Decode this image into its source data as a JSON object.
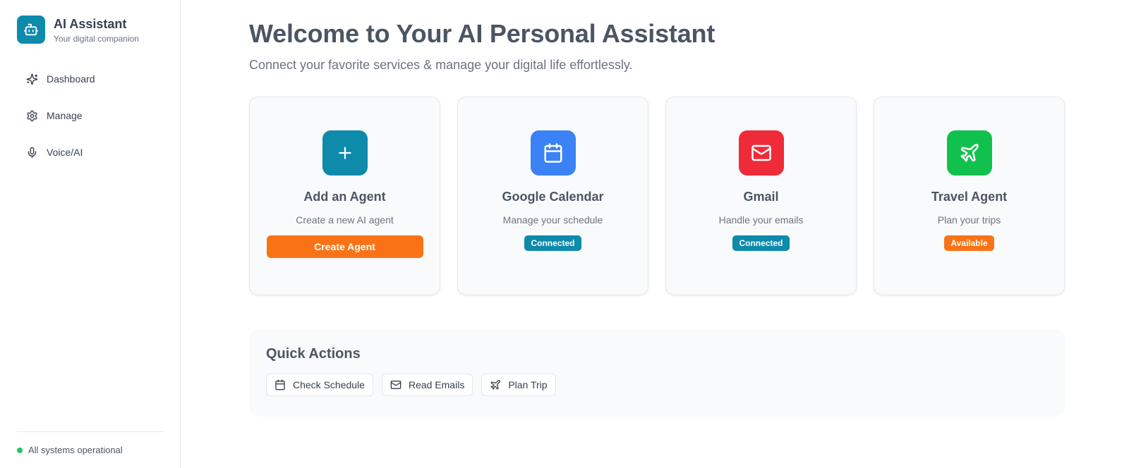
{
  "brand": {
    "title": "AI Assistant",
    "subtitle": "Your digital companion",
    "color": "#0e8aab",
    "icon": "bot-icon"
  },
  "nav": {
    "items": [
      {
        "label": "Dashboard",
        "icon": "sparkles-icon"
      },
      {
        "label": "Manage",
        "icon": "gear-icon"
      },
      {
        "label": "Voice/AI",
        "icon": "mic-icon"
      }
    ]
  },
  "status": {
    "text": "All systems operational",
    "color": "#22c55e"
  },
  "header": {
    "title": "Welcome to Your AI Personal Assistant",
    "subtitle": "Connect your favorite services & manage your digital life effortlessly."
  },
  "cards": [
    {
      "title": "Add an Agent",
      "description": "Create a new AI agent",
      "icon": "plus-icon",
      "icon_color": "#0e8aab",
      "button_label": "Create Agent",
      "button_color": "#f97316"
    },
    {
      "title": "Google Calendar",
      "description": "Manage your schedule",
      "icon": "calendar-icon",
      "icon_color": "#3b82f6",
      "badge": "Connected",
      "badge_color": "#0e8aab"
    },
    {
      "title": "Gmail",
      "description": "Handle your emails",
      "icon": "mail-icon",
      "icon_color": "#ef2b3a",
      "badge": "Connected",
      "badge_color": "#0e8aab"
    },
    {
      "title": "Travel Agent",
      "description": "Plan your trips",
      "icon": "plane-icon",
      "icon_color": "#10c24d",
      "badge": "Available",
      "badge_color": "#f97316"
    }
  ],
  "quick_actions": {
    "title": "Quick Actions",
    "items": [
      {
        "label": "Check Schedule",
        "icon": "calendar-icon"
      },
      {
        "label": "Read Emails",
        "icon": "mail-icon"
      },
      {
        "label": "Plan Trip",
        "icon": "plane-icon"
      }
    ]
  }
}
